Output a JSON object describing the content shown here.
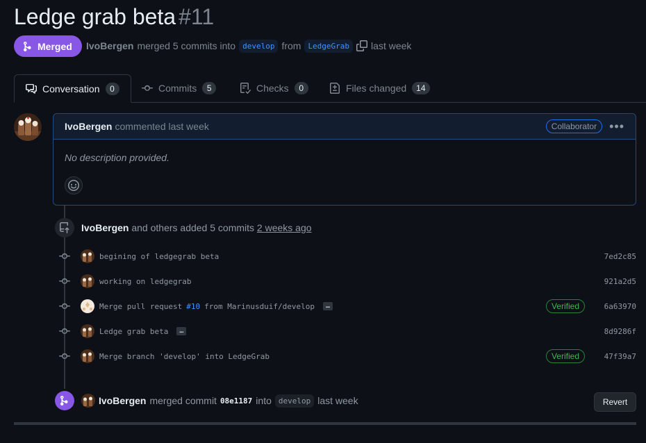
{
  "pr": {
    "title": "Ledge grab beta",
    "number": "#11",
    "state": "Merged",
    "author": "IvoBergen",
    "action": "merged 5 commits into",
    "base_branch": "develop",
    "from_word": "from",
    "head_branch": "LedgeGrab",
    "time": "last week"
  },
  "tabs": [
    {
      "label": "Conversation",
      "count": "0",
      "icon": "comment-discussion-icon"
    },
    {
      "label": "Commits",
      "count": "5",
      "icon": "git-commit-icon"
    },
    {
      "label": "Checks",
      "count": "0",
      "icon": "checklist-icon"
    },
    {
      "label": "Files changed",
      "count": "14",
      "icon": "file-diff-icon"
    }
  ],
  "comment": {
    "author": "IvoBergen",
    "action": "commented last week",
    "role": "Collaborator",
    "body": "No description provided."
  },
  "push_event": {
    "author": "IvoBergen",
    "text": "and others added 5 commits",
    "time": "2 weeks ago"
  },
  "commits": [
    {
      "message": "begining of ledgegrab beta",
      "sha": "7ed2c85",
      "verified": ""
    },
    {
      "message": "working on ledgegrab",
      "sha": "921a2d5",
      "verified": ""
    },
    {
      "message_pre": "Merge pull request",
      "message_link": "#10",
      "message_post": "from Marinusduif/develop",
      "sha": "6a63970",
      "verified": "Verified"
    },
    {
      "message": "Ledge grab beta",
      "sha": "8d9286f",
      "verified": ""
    },
    {
      "message": "Merge branch 'develop' into LedgeGrab",
      "sha": "47f39a7",
      "verified": "Verified"
    }
  ],
  "merge_event": {
    "author": "IvoBergen",
    "text": "merged commit",
    "sha": "08e1187",
    "into": "into",
    "branch": "develop",
    "time": "last week",
    "revert_label": "Revert"
  },
  "colors": {
    "background": "#0d1117",
    "merged_purple": "#8957e5",
    "link_blue": "#4493f8",
    "verified_green": "#3fb950"
  }
}
